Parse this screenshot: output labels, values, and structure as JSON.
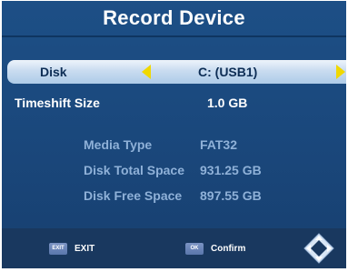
{
  "title": "Record Device",
  "settings": {
    "disk": {
      "label": "Disk",
      "value": "C: (USB1)"
    },
    "timeshift": {
      "label": "Timeshift Size",
      "value": "1.0 GB"
    }
  },
  "info": [
    {
      "label": "Media Type",
      "value": "FAT32"
    },
    {
      "label": "Disk Total Space",
      "value": "931.25 GB"
    },
    {
      "label": "Disk Free Space",
      "value": "897.55 GB"
    }
  ],
  "footer": {
    "exit_key": "EXIT",
    "exit_label": "EXIT",
    "ok_key": "OK",
    "confirm_label": "Confirm"
  },
  "colors": {
    "background": "#1a477b",
    "highlight": "#c9dcf0",
    "arrow": "#f0d800",
    "info_text": "#8fb1d8",
    "footer": "#19385f"
  },
  "icons": [
    "arrow-left-icon",
    "arrow-right-icon",
    "navigation-pad-icon"
  ]
}
